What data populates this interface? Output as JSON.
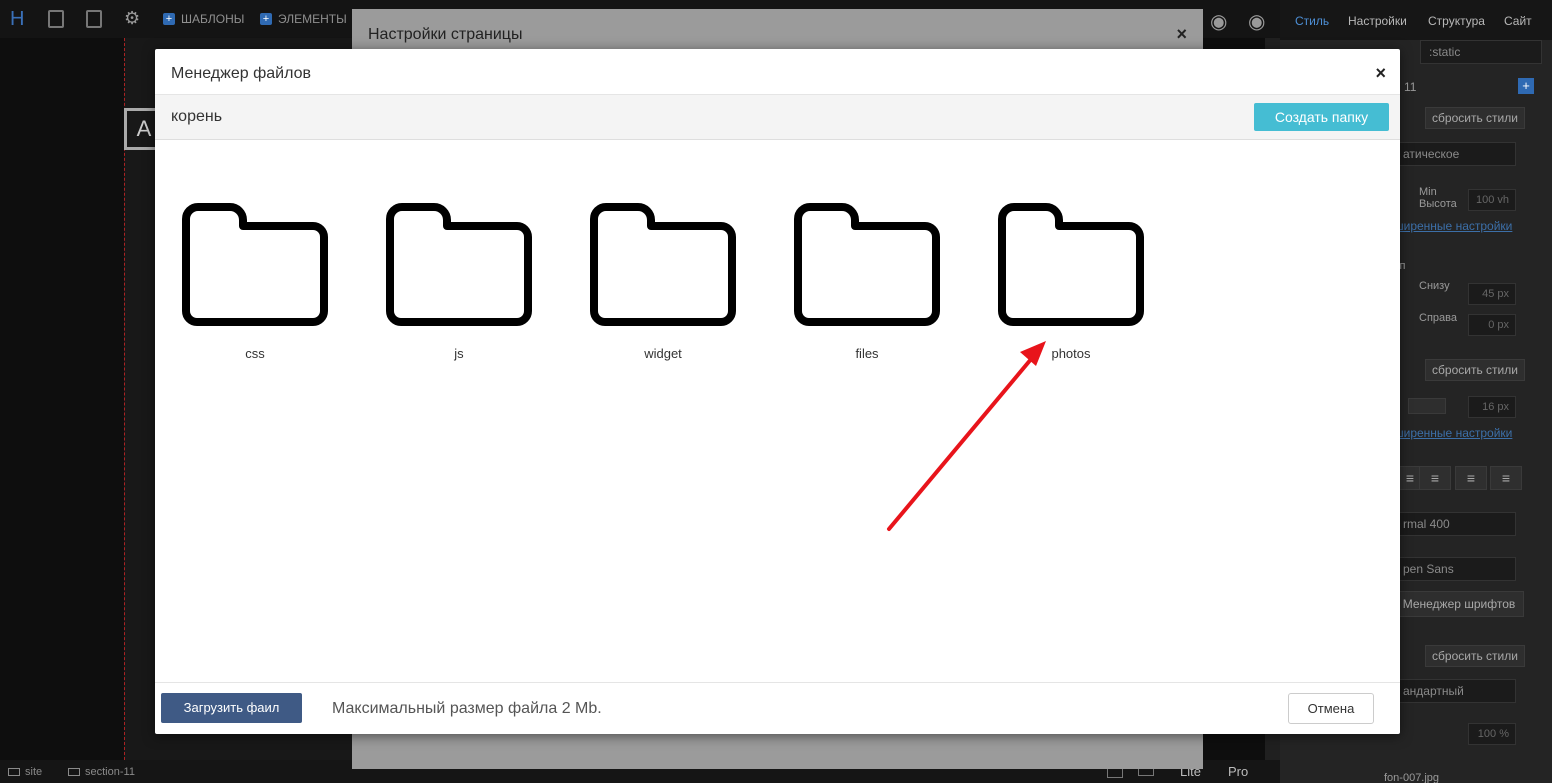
{
  "editor": {
    "toolbar": {
      "logo": "H",
      "templates_label": "ШАБЛОНЫ",
      "elements_label": "ЭЛЕМЕНТЫ"
    },
    "canvas_logo": "A",
    "right_panel": {
      "tabs": [
        "Стиль",
        "Настройки",
        "Структура",
        "Сайт"
      ],
      "position_value": ":static",
      "id_value": "11",
      "reset_styles_label": "сбросить стили",
      "display_value": "атическое",
      "min_height_label": "Min Высота",
      "min_height_value": "100 vh",
      "advanced_settings_link": "ширенные настройки",
      "indent_label": "уп",
      "bottom_label": "Снизу",
      "bottom_value": "45  px",
      "right_label": "Справа",
      "right_value": "0  px",
      "font_size_value": "16 px",
      "font_weight_value": "rmal 400",
      "font_family_value": "pen Sans",
      "font_manager_label": "Менеджер шрифтов",
      "standard_value": "андартный",
      "opacity_value": "100 %",
      "thumbnail_name": "fon-007.jpg"
    },
    "statusbar": {
      "site_label": "site",
      "section_label": "section-11",
      "mode_lite": "Lite",
      "mode_pro": "Pro"
    }
  },
  "background_modal": {
    "title": "Настройки страницы",
    "close_icon": "×"
  },
  "file_manager": {
    "title": "Менеджер файлов",
    "close_icon": "×",
    "path": "корень",
    "create_folder_label": "Создать папку",
    "folders": [
      {
        "name": "css",
        "icon": "folder-icon"
      },
      {
        "name": "js",
        "icon": "folder-icon"
      },
      {
        "name": "widget",
        "icon": "folder-icon"
      },
      {
        "name": "files",
        "icon": "folder-icon"
      },
      {
        "name": "photos",
        "icon": "folder-icon"
      }
    ],
    "upload_label": "Загрузить фаил",
    "max_size_text": "Максимальный размер файла 2 Mb.",
    "cancel_label": "Отмена"
  },
  "annotation": {
    "arrow_color": "#e8141b"
  },
  "colors": {
    "create_button": "#45bdd3",
    "upload_button": "#3f5a85",
    "accent_blue": "#2f6ab3"
  }
}
